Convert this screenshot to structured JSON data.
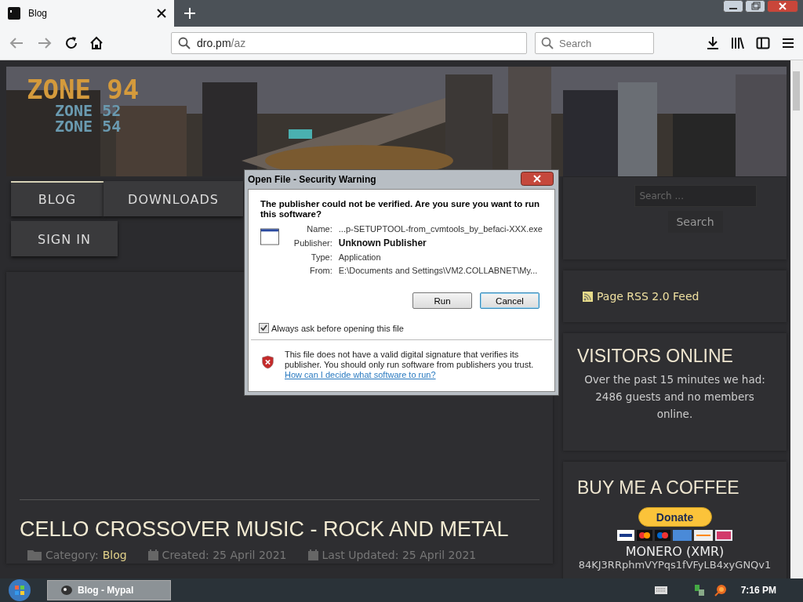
{
  "browser": {
    "tabs": [
      {
        "title": "Blog",
        "selected": true
      }
    ],
    "url": {
      "host": "dro.pm",
      "path": "/az"
    },
    "search": {
      "placeholder": "Search"
    }
  },
  "site": {
    "logo": [
      "ZONE 94",
      "ZONE 52",
      "ZONE 54"
    ],
    "nav": [
      {
        "label": "BLOG",
        "selected": true
      },
      {
        "label": "DOWNLOADS",
        "selected": false
      },
      {
        "label": "SIGN IN",
        "selected": false
      }
    ],
    "search": {
      "placeholder": "Search ...",
      "button": "Search"
    },
    "rss": "Page RSS 2.0 Feed",
    "visitors": {
      "title": "VISITORS ONLINE",
      "text": "Over the past 15 minutes we had: 2486 guests and no members online."
    },
    "coffee": {
      "title": "BUY ME A COFFEE",
      "donate": "Donate",
      "currency": "MONERO (XMR)",
      "address": "84KJ3RRphmVYPqs1fVFyLB4xyGNQv1"
    },
    "article": {
      "title": "CELLO CROSSOVER MUSIC - ROCK AND METAL",
      "meta": [
        {
          "kind": "category",
          "label": "Category:",
          "value": "Blog"
        },
        {
          "kind": "created",
          "label": "Created: 25 April 2021"
        },
        {
          "kind": "updated",
          "label": "Last Updated: 25 April 2021"
        }
      ]
    }
  },
  "dialog": {
    "title": "Open File - Security Warning",
    "heading": "The publisher could not be verified.  Are you sure you want to run this software?",
    "fields": [
      {
        "label": "Name:",
        "value": "...p-SETUPTOOL-from_cvmtools_by_befaci-XXX.exe",
        "bold": false
      },
      {
        "label": "Publisher:",
        "value": "Unknown Publisher",
        "bold": true
      },
      {
        "label": "Type:",
        "value": "Application",
        "bold": false
      },
      {
        "label": "From:",
        "value": "E:\\Documents and Settings\\VM2.COLLABNET\\My...",
        "bold": false
      }
    ],
    "buttons": [
      {
        "label": "Run",
        "default": false
      },
      {
        "label": "Cancel",
        "default": true
      }
    ],
    "checkbox": {
      "label": "Always ask before opening this file",
      "checked": true
    },
    "warning": "This file does not have a valid digital signature that verifies its publisher.  You should only run software from publishers you trust.",
    "link": "How can I decide what software to run?"
  },
  "taskbar": {
    "tasks": [
      {
        "label": "Blog - Mypal",
        "selected": true
      }
    ],
    "clock": "7:16 PM"
  }
}
